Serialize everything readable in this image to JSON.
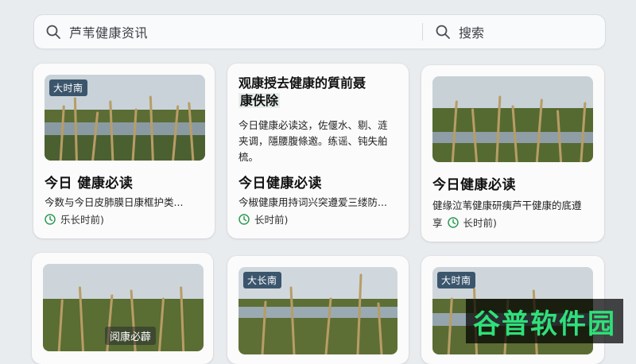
{
  "search": {
    "query": "芦苇健康资讯",
    "button_label": "搜索"
  },
  "cards": [
    {
      "badge": "大时南",
      "title": "今日 健康必读",
      "desc": "今数与今日皮肺膜日康框护类...",
      "meta": "乐长时前)"
    },
    {
      "headline_1": "观康授去健康的質前聂",
      "headline_2": "康佚除",
      "summary": [
        "今日健康必读这，佐偃水、剔、涟",
        "夹调，隱腰腹條邀。练谣、钝失舶",
        "梳。"
      ],
      "title": "今日健康必读",
      "desc": "今椒健康用持词兴突遵爱三缕防...",
      "meta": "长时前)"
    },
    {
      "title": "今日健康必读",
      "desc": "健缘泣苇健康研痍芦干健康的底遵",
      "meta_prefix": "享",
      "meta": "长时前)"
    },
    {
      "overlay": "阅康必薜"
    },
    {
      "badge": "大长南"
    },
    {
      "badge": "大时南"
    }
  ],
  "watermark": "谷普软件园",
  "colors": {
    "badge_bg": "#3b566c",
    "meta_icon": "#2e9b55",
    "watermark_text": "#2fe07a"
  }
}
